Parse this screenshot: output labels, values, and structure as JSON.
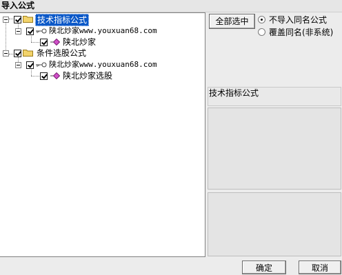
{
  "window": {
    "title": "导入公式"
  },
  "tree": {
    "groups": [
      {
        "label": "技术指标公式",
        "child": {
          "label": "陕北炒家www.youxuan68.com",
          "leaf": "陕北炒家"
        }
      },
      {
        "label": "条件选股公式",
        "child": {
          "label": "陕北炒家www.youxuan68.com",
          "leaf": "陕北炒家选股"
        }
      }
    ]
  },
  "actions": {
    "select_all": "全部选中"
  },
  "options": {
    "no_import_same_name": "不导入同名公式",
    "overwrite_same_name": "覆盖同名(非系统)",
    "selected": "no_import_same_name"
  },
  "detail": {
    "category": "技术指标公式"
  },
  "footer": {
    "ok": "确定",
    "cancel": "取消"
  }
}
